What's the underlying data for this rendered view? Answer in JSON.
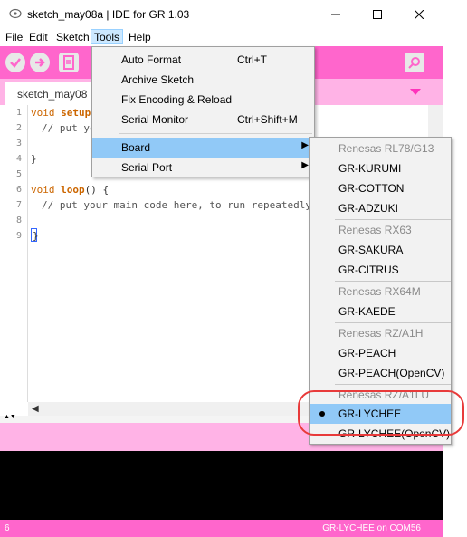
{
  "window": {
    "title": "sketch_may08a | IDE for GR 1.03"
  },
  "menubar": [
    "File",
    "Edit",
    "Sketch",
    "Tools",
    "Help"
  ],
  "tab": {
    "label": "sketch_may08"
  },
  "editor": {
    "line_numbers": [
      "1",
      "2",
      "3",
      "4",
      "5",
      "6",
      "7",
      "8",
      "9"
    ],
    "line1_kw": "void",
    "line1_fn": "setup",
    "line2_cm": "// put yo",
    "line4": "}",
    "line6_kw": "void",
    "line6_fn": "loop",
    "line6_rest": "() {",
    "line7_cm": "// put your main code here, to run repeatedly:",
    "line9": "}"
  },
  "tools_menu": {
    "auto_format": "Auto Format",
    "auto_format_sc": "Ctrl+T",
    "archive": "Archive Sketch",
    "fix_encoding": "Fix Encoding & Reload",
    "serial_monitor": "Serial Monitor",
    "serial_monitor_sc": "Ctrl+Shift+M",
    "board": "Board",
    "serial_port": "Serial Port"
  },
  "board_menu": {
    "h1": "Renesas RL78/G13",
    "kurumi": "GR-KURUMI",
    "cotton": "GR-COTTON",
    "adzuki": "GR-ADZUKI",
    "h2": "Renesas RX63",
    "sakura": "GR-SAKURA",
    "citrus": "GR-CITRUS",
    "h3": "Renesas RX64M",
    "kaede": "GR-KAEDE",
    "h4": "Renesas RZ/A1H",
    "peach": "GR-PEACH",
    "peach_cv": "GR-PEACH(OpenCV)",
    "h5": "Renesas RZ/A1LU",
    "lychee": "GR-LYCHEE",
    "lychee_cv": "GR-LYCHEE(OpenCV)"
  },
  "status": {
    "line": "6",
    "board_port": "GR-LYCHEE on COM56"
  },
  "colors": {
    "toolbar": "#ff66cc",
    "tabbar": "#ffb3e6",
    "highlight": "#91c9f7",
    "annotation": "#e83a3a"
  }
}
